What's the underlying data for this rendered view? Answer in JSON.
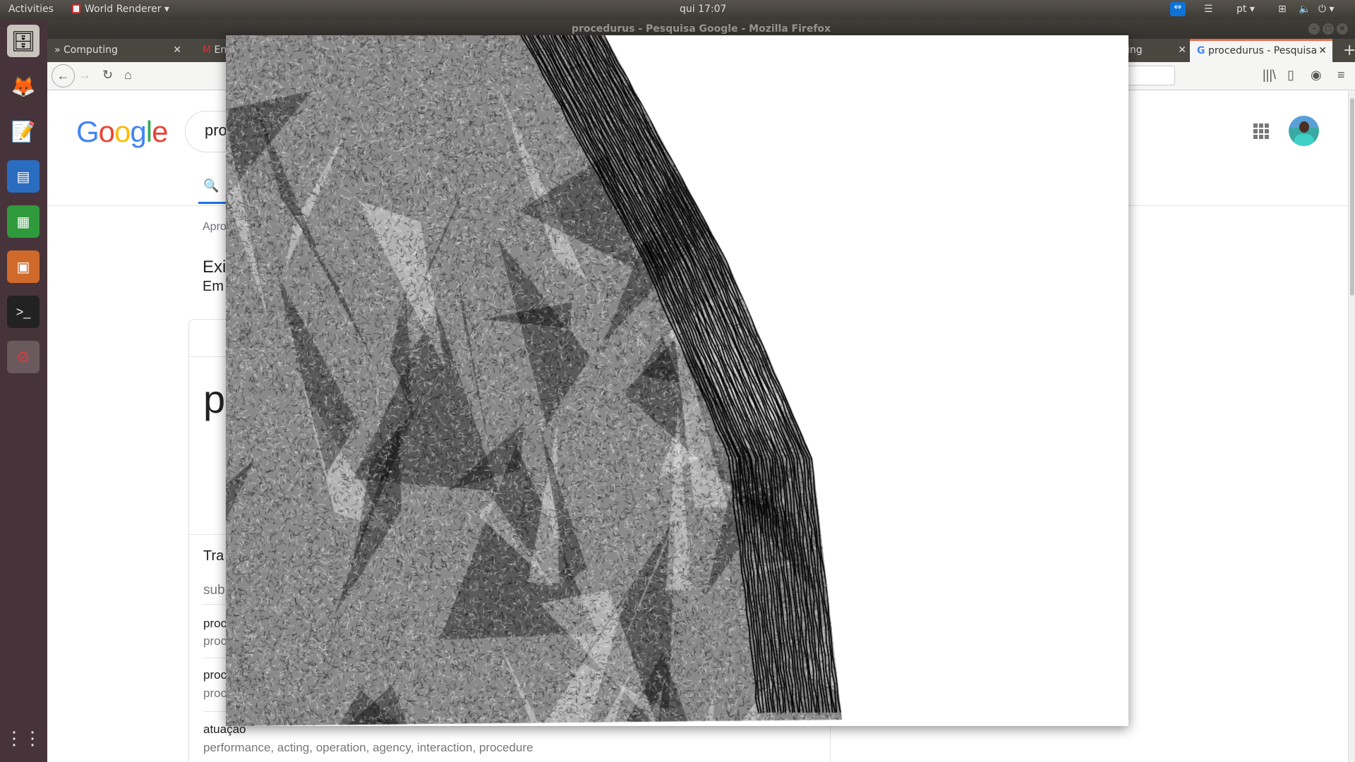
{
  "topbar": {
    "activities": "Activities",
    "app_menu": "World Renderer",
    "clock": "qui 17:07",
    "lang": "pt"
  },
  "window": {
    "title": "procedurus - Pesquisa Google - Mozilla Firefox"
  },
  "tabs": [
    {
      "label": "» Computing"
    },
    {
      "label": "En"
    },
    {
      "label": "ing"
    },
    {
      "label": "procedurus - Pesquisa"
    }
  ],
  "google": {
    "logo": "Google",
    "query": "pro",
    "results_info": "Apro",
    "heading1": "Exi",
    "heading2": "Em",
    "card_word": "p",
    "translations_title": "Tra",
    "subheader": "sub",
    "rows": [
      {
        "word": "proc",
        "syn": "proc"
      },
      {
        "word": "proc",
        "syn": "proc"
      },
      {
        "word": "atuação",
        "syn": "performance, acting, operation, agency, interaction, procedure"
      }
    ]
  },
  "renderer": {
    "title": "World Renderer"
  }
}
